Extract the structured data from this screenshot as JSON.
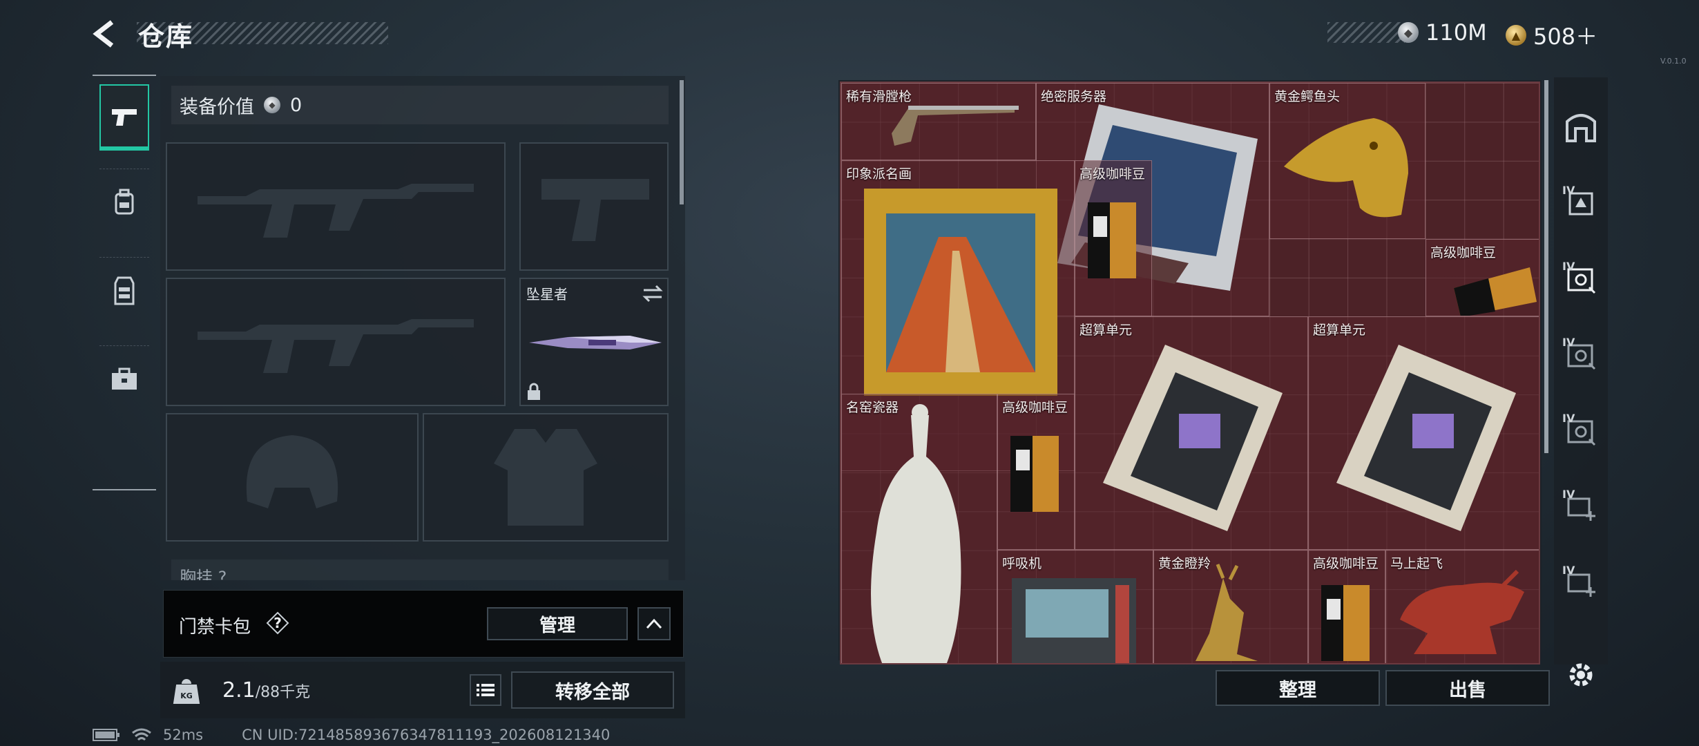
{
  "header": {
    "title": "仓库",
    "back_icon": "back-arrow-icon"
  },
  "currency": {
    "silver": "110M",
    "gold": "508＋"
  },
  "version": "V.0.1.0",
  "left_tabs": [
    {
      "name": "weapon-tab",
      "icon": "pistol-icon",
      "active": true
    },
    {
      "name": "backpack-tab",
      "icon": "backpack-icon"
    },
    {
      "name": "vest-tab",
      "icon": "vest-icon"
    },
    {
      "name": "case-tab",
      "icon": "toolbox-icon"
    }
  ],
  "equipment": {
    "value_label": "装备价值",
    "value": "0",
    "melee_name": "坠星者",
    "chest_label": "胸挂 ?"
  },
  "card_pack": {
    "label": "门禁卡包",
    "help": "?",
    "manage": "管理"
  },
  "weight": {
    "current": "2.1",
    "max": "/88千克"
  },
  "transfer_all": "转移全部",
  "warehouse": {
    "items": [
      {
        "id": "rare-shotgun",
        "label": "稀有滑膛枪"
      },
      {
        "id": "classified-server",
        "label": "绝密服务器"
      },
      {
        "id": "golden-croc",
        "label": "黄金鳄鱼头"
      },
      {
        "id": "impressionist-painting",
        "label": "印象派名画"
      },
      {
        "id": "coffee-1",
        "label": "高级咖啡豆"
      },
      {
        "id": "coffee-2",
        "label": "高级咖啡豆"
      },
      {
        "id": "supercomputer-1",
        "label": "超算单元"
      },
      {
        "id": "supercomputer-2",
        "label": "超算单元"
      },
      {
        "id": "famous-porcelain",
        "label": "名窑瓷器"
      },
      {
        "id": "coffee-3",
        "label": "高级咖啡豆"
      },
      {
        "id": "respirator",
        "label": "呼吸机"
      },
      {
        "id": "golden-antelope",
        "label": "黄金瞪羚"
      },
      {
        "id": "coffee-4",
        "label": "高级咖啡豆"
      },
      {
        "id": "horse-statue",
        "label": "马上起飞"
      }
    ],
    "sort": "整理",
    "sell": "出售"
  },
  "right_tabs": [
    "warehouse-tab",
    "IV",
    "IV",
    "IV",
    "IV",
    "IV",
    "IV"
  ],
  "status": {
    "ping": "52ms",
    "uid": "CN UID:721485893676347811193_202608121340"
  },
  "colors": {
    "accent": "#23c7a4",
    "grid_bg": "#4c2227"
  }
}
